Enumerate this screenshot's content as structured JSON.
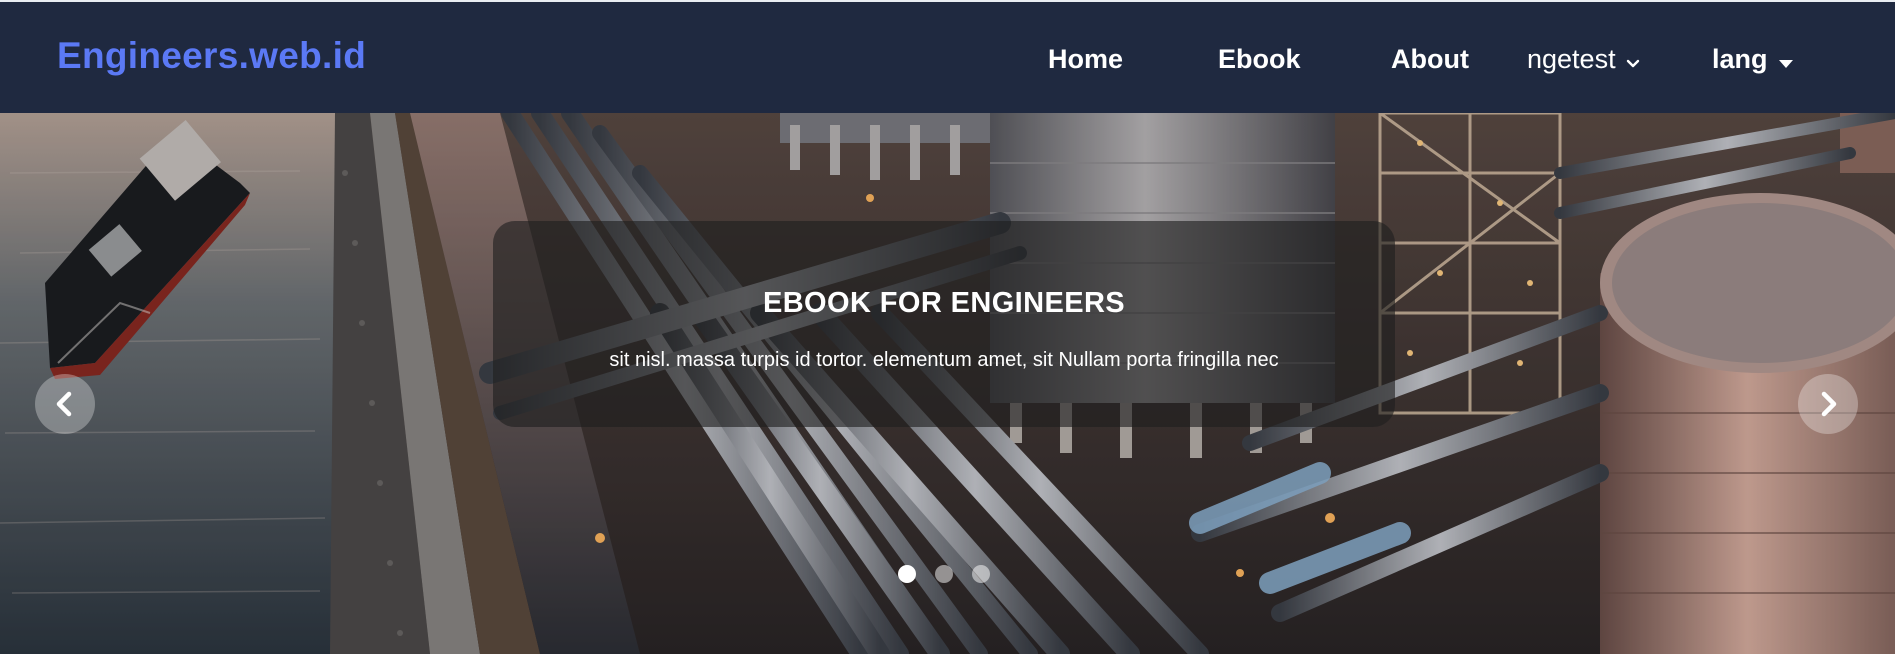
{
  "brand": {
    "name": "Engineers.web.id",
    "color": "#5b79f5"
  },
  "nav": {
    "home": "Home",
    "ebook": "Ebook",
    "about": "About",
    "ngetest": "ngetest",
    "lang": "lang"
  },
  "hero": {
    "caption_title": "EBOOK FOR ENGINEERS",
    "caption_text": "sit nisl. massa turpis id tortor. elementum amet, sit Nullam porta fringilla nec",
    "slide_count": 3,
    "active_slide": 1,
    "prev_icon": "chevron-left-icon",
    "next_icon": "chevron-right-icon"
  },
  "colors": {
    "navbar_bg": "#1f2940",
    "text": "#ffffff"
  }
}
